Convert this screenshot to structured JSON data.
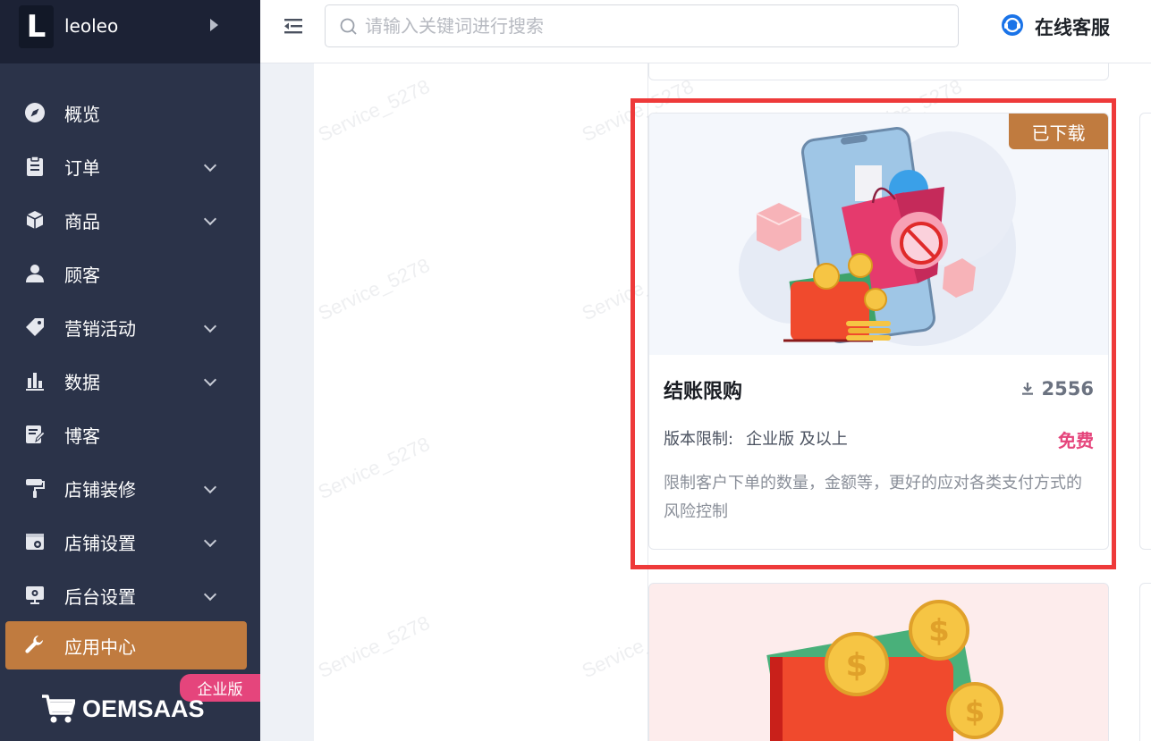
{
  "sidebar": {
    "logo_letter": "L",
    "store_name": "leoleo",
    "items": [
      {
        "label": "概览"
      },
      {
        "label": "订单"
      },
      {
        "label": "商品"
      },
      {
        "label": "顾客"
      },
      {
        "label": "营销活动"
      },
      {
        "label": "数据"
      },
      {
        "label": "博客"
      },
      {
        "label": "店铺装修"
      },
      {
        "label": "店铺设置"
      },
      {
        "label": "后台设置"
      },
      {
        "label": "应用中心"
      }
    ],
    "edition_badge": "企业版",
    "brand": "OEMSAAS"
  },
  "topbar": {
    "search_placeholder": "请输入关键词进行搜索",
    "support_label": "在线客服"
  },
  "watermark_text": "Service_5278",
  "app_card": {
    "status_tag": "已下载",
    "title": "结账限购",
    "downloads": "2556",
    "version_label": "版本限制:",
    "version_value": "企业版 及以上",
    "price": "免费",
    "description": "限制客户下单的数量，金额等，更好的应对各类支付方式的风险控制"
  },
  "colors": {
    "sidebar_bg": "#2b3349",
    "active_bg": "#c07b3f",
    "accent_pink": "#e5457c",
    "highlight_red": "#ee3a3a"
  }
}
